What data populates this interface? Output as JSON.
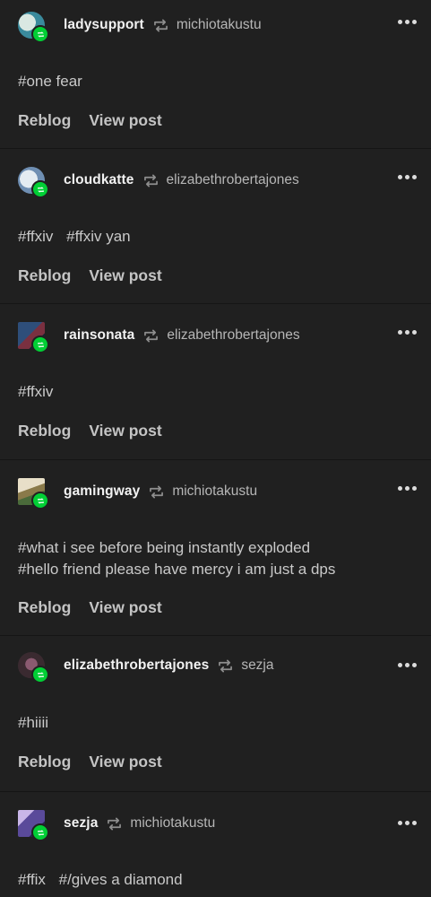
{
  "posts": [
    {
      "username": "ladysupport",
      "source": "michiotakustu",
      "avatar_colors": [
        "#3a8a9c",
        "#d9e8e2"
      ],
      "tags": [
        "#one fear"
      ],
      "reblog_label": "Reblog",
      "view_label": "View post"
    },
    {
      "username": "cloudkatte",
      "source": "elizabethrobertajones",
      "avatar_colors": [
        "#6f8fb3",
        "#e4ecf2"
      ],
      "tags": [
        "#ffxiv",
        "#ffxiv yan"
      ],
      "reblog_label": "Reblog",
      "view_label": "View post"
    },
    {
      "username": "rainsonata",
      "source": "elizabethrobertajones",
      "avatar_colors": [
        "#2e4e7a",
        "#7a3040"
      ],
      "tags": [
        "#ffxiv"
      ],
      "reblog_label": "Reblog",
      "view_label": "View post"
    },
    {
      "username": "gamingway",
      "source": "michiotakustu",
      "avatar_colors": [
        "#e8dfc8",
        "#8a7a4a"
      ],
      "tag_lines": [
        "#what i see before being instantly exploded",
        "#hello friend please have mercy i am just a dps"
      ],
      "reblog_label": "Reblog",
      "view_label": "View post"
    },
    {
      "username": "elizabethrobertajones",
      "source": "sezja",
      "avatar_colors": [
        "#3a2a30",
        "#8a5a70"
      ],
      "tags": [
        "#hiiii"
      ],
      "reblog_label": "Reblog",
      "view_label": "View post"
    },
    {
      "username": "sezja",
      "source": "michiotakustu",
      "avatar_colors": [
        "#5a4a9a",
        "#c9b6e8"
      ],
      "tags": [
        "#ffix",
        "#/gives a diamond"
      ]
    }
  ],
  "colors": {
    "background": "#202020",
    "reblog_badge": "#01cf35",
    "divider": "#151515"
  },
  "icons": {
    "reblog": "reblog-icon",
    "more": "more-options-icon"
  }
}
